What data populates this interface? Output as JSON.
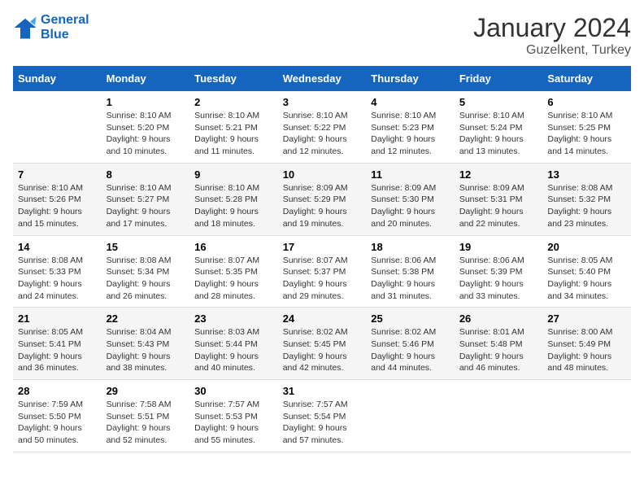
{
  "logo": {
    "line1": "General",
    "line2": "Blue"
  },
  "title": "January 2024",
  "subtitle": "Guzelkent, Turkey",
  "days_header": [
    "Sunday",
    "Monday",
    "Tuesday",
    "Wednesday",
    "Thursday",
    "Friday",
    "Saturday"
  ],
  "weeks": [
    [
      {
        "num": "",
        "sunrise": "",
        "sunset": "",
        "daylight": ""
      },
      {
        "num": "1",
        "sunrise": "Sunrise: 8:10 AM",
        "sunset": "Sunset: 5:20 PM",
        "daylight": "Daylight: 9 hours and 10 minutes."
      },
      {
        "num": "2",
        "sunrise": "Sunrise: 8:10 AM",
        "sunset": "Sunset: 5:21 PM",
        "daylight": "Daylight: 9 hours and 11 minutes."
      },
      {
        "num": "3",
        "sunrise": "Sunrise: 8:10 AM",
        "sunset": "Sunset: 5:22 PM",
        "daylight": "Daylight: 9 hours and 12 minutes."
      },
      {
        "num": "4",
        "sunrise": "Sunrise: 8:10 AM",
        "sunset": "Sunset: 5:23 PM",
        "daylight": "Daylight: 9 hours and 12 minutes."
      },
      {
        "num": "5",
        "sunrise": "Sunrise: 8:10 AM",
        "sunset": "Sunset: 5:24 PM",
        "daylight": "Daylight: 9 hours and 13 minutes."
      },
      {
        "num": "6",
        "sunrise": "Sunrise: 8:10 AM",
        "sunset": "Sunset: 5:25 PM",
        "daylight": "Daylight: 9 hours and 14 minutes."
      }
    ],
    [
      {
        "num": "7",
        "sunrise": "Sunrise: 8:10 AM",
        "sunset": "Sunset: 5:26 PM",
        "daylight": "Daylight: 9 hours and 15 minutes."
      },
      {
        "num": "8",
        "sunrise": "Sunrise: 8:10 AM",
        "sunset": "Sunset: 5:27 PM",
        "daylight": "Daylight: 9 hours and 17 minutes."
      },
      {
        "num": "9",
        "sunrise": "Sunrise: 8:10 AM",
        "sunset": "Sunset: 5:28 PM",
        "daylight": "Daylight: 9 hours and 18 minutes."
      },
      {
        "num": "10",
        "sunrise": "Sunrise: 8:09 AM",
        "sunset": "Sunset: 5:29 PM",
        "daylight": "Daylight: 9 hours and 19 minutes."
      },
      {
        "num": "11",
        "sunrise": "Sunrise: 8:09 AM",
        "sunset": "Sunset: 5:30 PM",
        "daylight": "Daylight: 9 hours and 20 minutes."
      },
      {
        "num": "12",
        "sunrise": "Sunrise: 8:09 AM",
        "sunset": "Sunset: 5:31 PM",
        "daylight": "Daylight: 9 hours and 22 minutes."
      },
      {
        "num": "13",
        "sunrise": "Sunrise: 8:08 AM",
        "sunset": "Sunset: 5:32 PM",
        "daylight": "Daylight: 9 hours and 23 minutes."
      }
    ],
    [
      {
        "num": "14",
        "sunrise": "Sunrise: 8:08 AM",
        "sunset": "Sunset: 5:33 PM",
        "daylight": "Daylight: 9 hours and 24 minutes."
      },
      {
        "num": "15",
        "sunrise": "Sunrise: 8:08 AM",
        "sunset": "Sunset: 5:34 PM",
        "daylight": "Daylight: 9 hours and 26 minutes."
      },
      {
        "num": "16",
        "sunrise": "Sunrise: 8:07 AM",
        "sunset": "Sunset: 5:35 PM",
        "daylight": "Daylight: 9 hours and 28 minutes."
      },
      {
        "num": "17",
        "sunrise": "Sunrise: 8:07 AM",
        "sunset": "Sunset: 5:37 PM",
        "daylight": "Daylight: 9 hours and 29 minutes."
      },
      {
        "num": "18",
        "sunrise": "Sunrise: 8:06 AM",
        "sunset": "Sunset: 5:38 PM",
        "daylight": "Daylight: 9 hours and 31 minutes."
      },
      {
        "num": "19",
        "sunrise": "Sunrise: 8:06 AM",
        "sunset": "Sunset: 5:39 PM",
        "daylight": "Daylight: 9 hours and 33 minutes."
      },
      {
        "num": "20",
        "sunrise": "Sunrise: 8:05 AM",
        "sunset": "Sunset: 5:40 PM",
        "daylight": "Daylight: 9 hours and 34 minutes."
      }
    ],
    [
      {
        "num": "21",
        "sunrise": "Sunrise: 8:05 AM",
        "sunset": "Sunset: 5:41 PM",
        "daylight": "Daylight: 9 hours and 36 minutes."
      },
      {
        "num": "22",
        "sunrise": "Sunrise: 8:04 AM",
        "sunset": "Sunset: 5:43 PM",
        "daylight": "Daylight: 9 hours and 38 minutes."
      },
      {
        "num": "23",
        "sunrise": "Sunrise: 8:03 AM",
        "sunset": "Sunset: 5:44 PM",
        "daylight": "Daylight: 9 hours and 40 minutes."
      },
      {
        "num": "24",
        "sunrise": "Sunrise: 8:02 AM",
        "sunset": "Sunset: 5:45 PM",
        "daylight": "Daylight: 9 hours and 42 minutes."
      },
      {
        "num": "25",
        "sunrise": "Sunrise: 8:02 AM",
        "sunset": "Sunset: 5:46 PM",
        "daylight": "Daylight: 9 hours and 44 minutes."
      },
      {
        "num": "26",
        "sunrise": "Sunrise: 8:01 AM",
        "sunset": "Sunset: 5:48 PM",
        "daylight": "Daylight: 9 hours and 46 minutes."
      },
      {
        "num": "27",
        "sunrise": "Sunrise: 8:00 AM",
        "sunset": "Sunset: 5:49 PM",
        "daylight": "Daylight: 9 hours and 48 minutes."
      }
    ],
    [
      {
        "num": "28",
        "sunrise": "Sunrise: 7:59 AM",
        "sunset": "Sunset: 5:50 PM",
        "daylight": "Daylight: 9 hours and 50 minutes."
      },
      {
        "num": "29",
        "sunrise": "Sunrise: 7:58 AM",
        "sunset": "Sunset: 5:51 PM",
        "daylight": "Daylight: 9 hours and 52 minutes."
      },
      {
        "num": "30",
        "sunrise": "Sunrise: 7:57 AM",
        "sunset": "Sunset: 5:53 PM",
        "daylight": "Daylight: 9 hours and 55 minutes."
      },
      {
        "num": "31",
        "sunrise": "Sunrise: 7:57 AM",
        "sunset": "Sunset: 5:54 PM",
        "daylight": "Daylight: 9 hours and 57 minutes."
      },
      {
        "num": "",
        "sunrise": "",
        "sunset": "",
        "daylight": ""
      },
      {
        "num": "",
        "sunrise": "",
        "sunset": "",
        "daylight": ""
      },
      {
        "num": "",
        "sunrise": "",
        "sunset": "",
        "daylight": ""
      }
    ]
  ]
}
